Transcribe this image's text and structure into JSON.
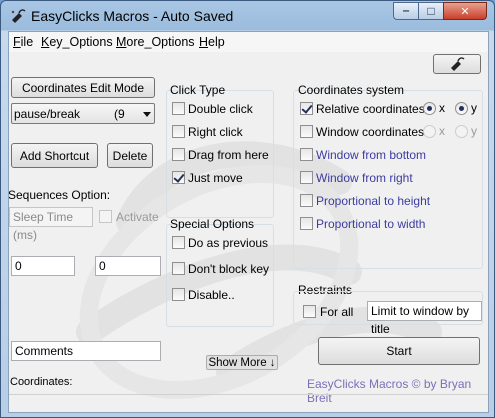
{
  "window": {
    "title": "EasyClicks Macros - Auto Saved",
    "min_glyph": "‒",
    "max_glyph": "□",
    "close_glyph": "✕"
  },
  "menu": [
    {
      "label": "File",
      "underline": "F",
      "rest": "ile"
    },
    {
      "label": "Key_Options",
      "underline": "K",
      "rest": "ey_Options"
    },
    {
      "label": "More_Options",
      "underline": "M",
      "rest": "ore_Options"
    },
    {
      "label": "Help",
      "underline": "H",
      "rest": "elp"
    }
  ],
  "left": {
    "coord_edit_mode": "Coordinates Edit Mode",
    "key_combo": {
      "value": "pause/break",
      "num": "(9"
    },
    "add_shortcut": "Add Shortcut",
    "delete": "Delete",
    "sequences_label": "Sequences Option:",
    "sleep_placeholder": "Sleep Time (ms)",
    "activate": "Activate",
    "field1": "0",
    "field2": "0",
    "comments": "Comments",
    "show_more": "Show More ↓"
  },
  "click_type": {
    "title": "Click Type",
    "options": [
      {
        "label": "Double click",
        "checked": false
      },
      {
        "label": "Right click",
        "checked": false
      },
      {
        "label": "Drag from here",
        "checked": false
      },
      {
        "label": "Just move",
        "checked": true
      }
    ]
  },
  "special": {
    "title": "Special Options",
    "options": [
      {
        "label": "Do as previous",
        "checked": false
      },
      {
        "label": "Don't block key",
        "checked": false
      },
      {
        "label": "Disable..",
        "checked": false
      }
    ]
  },
  "coords": {
    "title": "Coordinates system",
    "relative": {
      "label": "Relative coordinates",
      "checked": true
    },
    "window": {
      "label": "Window coordinates",
      "checked": false
    },
    "x_label": "x",
    "y_label": "y",
    "from_bottom": "Window from bottom",
    "from_right": "Window from right",
    "prop_height": "Proportional to height",
    "prop_width": "Proportional to width"
  },
  "restraints": {
    "title": "Restraints",
    "for_all": "For all",
    "limit_field": "Limit to window by title"
  },
  "start": "Start",
  "credit": "EasyClicks Macros © by Bryan Breit",
  "status_label": "Coordinates:",
  "colors": {
    "accent_link": "#7a70b8",
    "title_bar": "#9bbcde",
    "close_button": "#c8402a"
  }
}
